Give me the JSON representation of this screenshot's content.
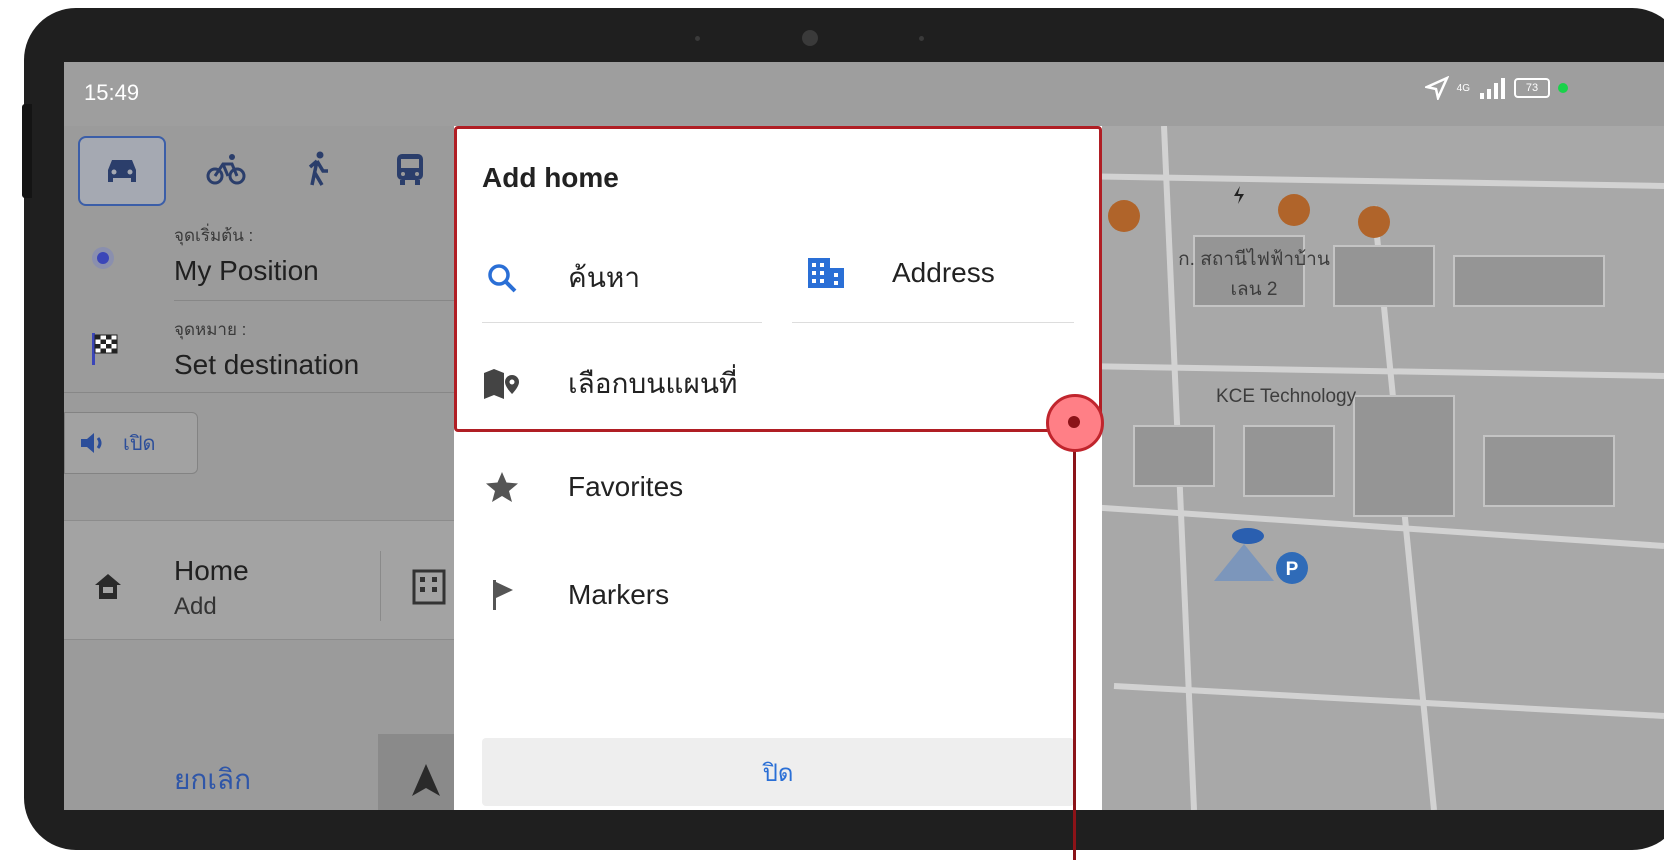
{
  "status_bar": {
    "time": "15:49",
    "network": "4G",
    "battery": "73",
    "icons": [
      "location-arrow-icon",
      "signal-icon",
      "battery-icon"
    ]
  },
  "route_panel": {
    "modes": [
      "car-icon",
      "bike-icon",
      "walk-icon",
      "bus-icon"
    ],
    "start_label": "จุดเริ่มต้น :",
    "start_value": "My Position",
    "dest_label": "จุดหมาย :",
    "dest_value": "Set destination",
    "sound_label": "เปิด",
    "home_title": "Home",
    "home_sub": "Add",
    "cancel_label": "ยกเลิก"
  },
  "dialog": {
    "title": "Add home",
    "options": {
      "search": "ค้นหา",
      "address": "Address",
      "pick_on_map": "เลือกบนแผนที่",
      "favorites": "Favorites",
      "markers": "Markers"
    },
    "close_label": "ปิด"
  },
  "map": {
    "labels": {
      "power_line1": "ก. สถานีไฟฟ้าบ้าน",
      "power_line2": "เลน 2",
      "kce": "KCE Technology"
    },
    "parking": "P"
  },
  "colors": {
    "accent": "#2a6fd6",
    "highlight": "#b01e24",
    "poi": "#b0642a"
  }
}
